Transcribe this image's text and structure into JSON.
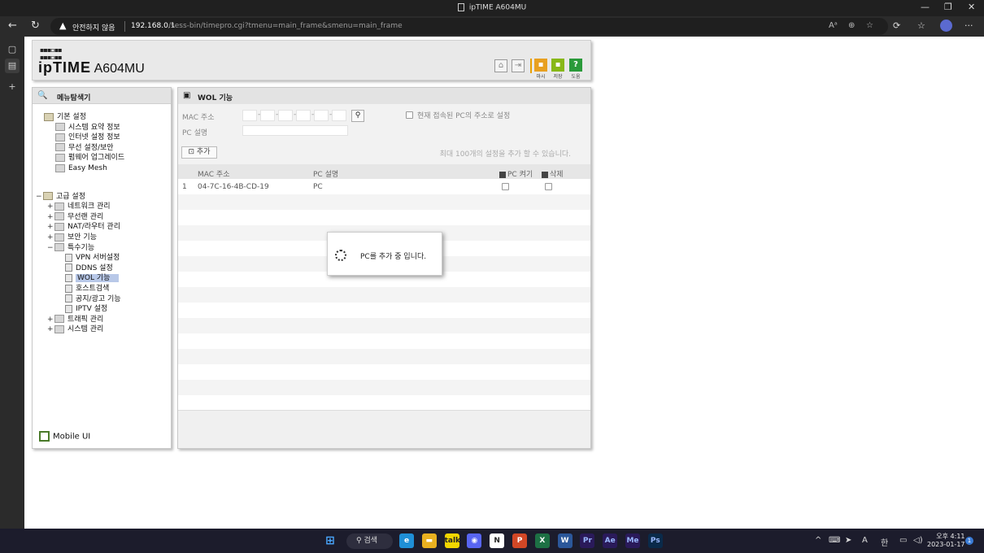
{
  "window": {
    "title": "ipTIME A604MU",
    "min_glyph": "—",
    "restore_glyph": "❐",
    "close_glyph": "✕"
  },
  "browser": {
    "back_glyph": "←",
    "reload_glyph": "↻",
    "security_warning": "안전하지 않음",
    "url_host": "192.168.0.1",
    "url_path": "/sess-bin/timepro.cgi?tmenu=main_frame&smenu=main_frame",
    "more_glyph": "···"
  },
  "router": {
    "logo_brand": "ipTIME",
    "logo_model": "A604MU",
    "header_buttons": [
      {
        "label": "마시",
        "color": "#e8a020",
        "glyph": "▪"
      },
      {
        "label": "저장",
        "color": "#88b818",
        "glyph": "▪"
      },
      {
        "label": "도움",
        "color": "#2a9a3a",
        "glyph": "?"
      }
    ]
  },
  "menu": {
    "title": "메뉴탐색기",
    "tree": [
      {
        "label": "기본 설정",
        "level": 0,
        "toggle": "",
        "icon": "folder"
      },
      {
        "label": "시스템 요약 정보",
        "level": 1,
        "toggle": "",
        "icon": "item"
      },
      {
        "label": "인터넷 설정 정보",
        "level": 1,
        "toggle": "",
        "icon": "item"
      },
      {
        "label": "무선 설정/보안",
        "level": 1,
        "toggle": "",
        "icon": "item"
      },
      {
        "label": "펌웨어 업그레이드",
        "level": 1,
        "toggle": "",
        "icon": "item"
      },
      {
        "label": "Easy Mesh",
        "level": 1,
        "toggle": "",
        "icon": "item"
      },
      {
        "label": "고급 설정",
        "level": 0,
        "toggle": "−",
        "icon": "folder"
      },
      {
        "label": "네트워크 관리",
        "level": 1,
        "toggle": "+",
        "icon": "item"
      },
      {
        "label": "무선랜 관리",
        "level": 1,
        "toggle": "+",
        "icon": "item"
      },
      {
        "label": "NAT/라우터 관리",
        "level": 1,
        "toggle": "+",
        "icon": "item"
      },
      {
        "label": "보안 기능",
        "level": 1,
        "toggle": "+",
        "icon": "item"
      },
      {
        "label": "특수기능",
        "level": 1,
        "toggle": "−",
        "icon": "item"
      },
      {
        "label": "VPN 서버설정",
        "level": 2,
        "toggle": "",
        "icon": "page"
      },
      {
        "label": "DDNS 설정",
        "level": 2,
        "toggle": "",
        "icon": "page"
      },
      {
        "label": "WOL 기능",
        "level": 2,
        "toggle": "",
        "icon": "page",
        "selected": true
      },
      {
        "label": "호스트검색",
        "level": 2,
        "toggle": "",
        "icon": "page"
      },
      {
        "label": "공지/광고 기능",
        "level": 2,
        "toggle": "",
        "icon": "page"
      },
      {
        "label": "IPTV 설정",
        "level": 2,
        "toggle": "",
        "icon": "page"
      },
      {
        "label": "트래픽 관리",
        "level": 1,
        "toggle": "+",
        "icon": "item"
      },
      {
        "label": "시스템 관리",
        "level": 1,
        "toggle": "+",
        "icon": "item"
      }
    ],
    "mobile_ui": "Mobile UI"
  },
  "wol": {
    "title": "WOL 기능",
    "mac_label": "MAC 주소",
    "desc_label": "PC 설명",
    "current_pc_label": "현재 접속된 PC의 주소로 설정",
    "add_button": "추가",
    "limit_note": "최대 100개의 설정을 추가 할 수 있습니다.",
    "columns": {
      "mac": "MAC 주소",
      "desc": "PC 설명",
      "wake": "PC 켜기",
      "delete": "삭제"
    },
    "rows": [
      {
        "index": "1",
        "mac": "04-7C-16-4B-CD-19",
        "desc": "PC"
      }
    ]
  },
  "dialog": {
    "message": "PC를 추가 중 입니다."
  },
  "taskbar": {
    "search_label": "검색",
    "apps": [
      {
        "name": "Edge",
        "glyph": "e",
        "color": "#1f8fd6"
      },
      {
        "name": "Files",
        "glyph": "▬",
        "color": "#e8b020"
      },
      {
        "name": "KakaoTalk",
        "glyph": "talk",
        "color": "#f2d600"
      },
      {
        "name": "Discord",
        "glyph": "◉",
        "color": "#5865f2"
      },
      {
        "name": "Notion",
        "glyph": "N",
        "color": "#ffffff"
      },
      {
        "name": "PowerPoint",
        "glyph": "P",
        "color": "#d24726"
      },
      {
        "name": "Excel",
        "glyph": "X",
        "color": "#1d7044"
      },
      {
        "name": "Word",
        "glyph": "W",
        "color": "#2b579a"
      },
      {
        "name": "Premiere",
        "glyph": "Pr",
        "color": "#2a1a5a"
      },
      {
        "name": "After Effects",
        "glyph": "Ae",
        "color": "#2a1a5a"
      },
      {
        "name": "Media Encoder",
        "glyph": "Me",
        "color": "#2a1a5a"
      },
      {
        "name": "Photoshop",
        "glyph": "Ps",
        "color": "#0a2a4a"
      }
    ],
    "ime_a": "A",
    "ime_han": "한",
    "time": "오후 4:11",
    "date": "2023-01-17",
    "notifications": "1"
  }
}
